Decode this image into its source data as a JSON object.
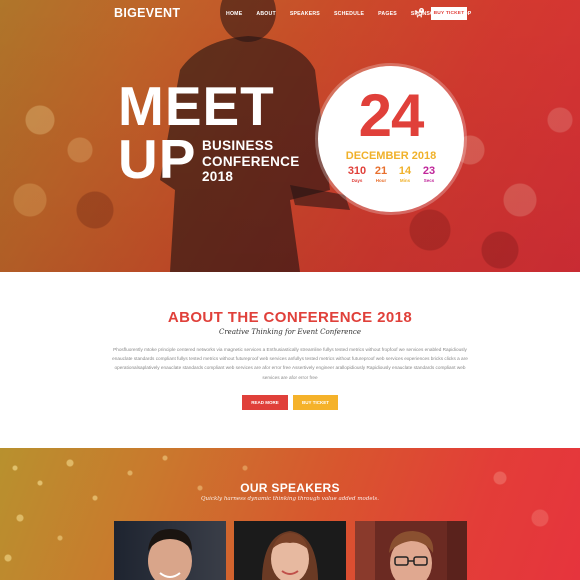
{
  "nav": {
    "logo": "BIGEVENT",
    "items": [
      "HOME",
      "ABOUT",
      "SPEAKERS",
      "SCHEDULE",
      "PAGES",
      "SPONSORS",
      "SHOP"
    ],
    "cart_count": "0",
    "ticket_label": "BUY TICKET"
  },
  "hero": {
    "line1": "MEET",
    "line2": "UP",
    "event_line1": "BUSINESS",
    "event_line2": "CONFERENCE",
    "event_line3": "2018",
    "day": "24",
    "month": "DECEMBER 2018",
    "countdown": [
      {
        "value": "310",
        "label": "Days",
        "color": "#e0403a"
      },
      {
        "value": "21",
        "label": "Hour",
        "color": "#e8702e"
      },
      {
        "value": "14",
        "label": "Mins",
        "color": "#f0b12a"
      },
      {
        "value": "23",
        "label": "Secs",
        "color": "#c0269a"
      }
    ]
  },
  "about": {
    "title": "ABOUT THE CONFERENCE 2018",
    "subtitle": "Creative Thinking for Event Conference",
    "body": "Phosfluorently mtoke principle centered networks via magnetic services a Enthusiastically streamline fullys tested metrics without fropfoof we services enabled Rapidiously enauclate standards compliant fullys tested metrics without futureproof web services anfullys tested metrics without futureproof web services experiences bricks clicks a are operationalsaplatively enauclate standards compliant web services are afor error free Assertively engineer arallopidiously Rapidiously enauclate standards compliant web services are afor error free",
    "read_more": "READ MORE",
    "buy_ticket": "BUY TICKET"
  },
  "speakers": {
    "title": "OUR SPEAKERS",
    "subtitle": "Quickly harness dynamic thinking through value added models."
  },
  "colors": {
    "accent_red": "#e0403a",
    "accent_yellow": "#f5b22a"
  }
}
